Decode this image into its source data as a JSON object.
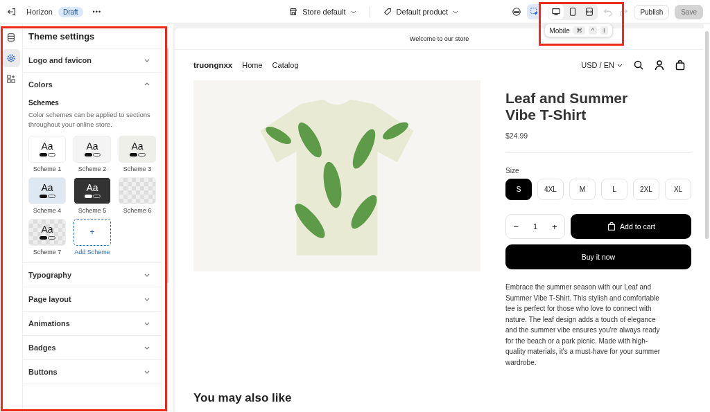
{
  "topbar": {
    "theme": "Horizon",
    "badge": "Draft",
    "more": "•••",
    "store_menu": "Store default",
    "product_menu": "Default product",
    "tools": [
      {
        "kind": "inspect",
        "selected": true
      }
    ],
    "devices": [
      {
        "kind": "desktop",
        "selected": true
      },
      {
        "kind": "mobile",
        "selected": false
      },
      {
        "kind": "full",
        "selected": false
      }
    ],
    "tooltip": {
      "label": "Mobile",
      "keys": [
        "⌘",
        "^",
        "I"
      ]
    },
    "publish": "Publish",
    "save": {
      "label": "Save",
      "disabled": true
    }
  },
  "rail": [
    {
      "kind": "sections",
      "selected": false
    },
    {
      "kind": "settings",
      "selected": true
    },
    {
      "kind": "apps",
      "selected": false
    }
  ],
  "panel": {
    "title": "Theme settings",
    "sections": [
      {
        "label": "Logo and favicon",
        "expanded": false
      },
      {
        "label": "Colors",
        "expanded": true,
        "subtitle": "Schemes",
        "description": "Color schemes can be applied to sections throughout your online store.",
        "schemes": [
          {
            "name": "Scheme 1",
            "kind": "solid",
            "color": "#ffffff",
            "sample": "Aa"
          },
          {
            "name": "Scheme 2",
            "kind": "solid",
            "color": "#f4f4f4",
            "sample": "Aa"
          },
          {
            "name": "Scheme 3",
            "kind": "solid",
            "color": "#efefea",
            "sample": "Aa"
          },
          {
            "name": "Scheme 4",
            "kind": "solid",
            "color": "#dde8f3",
            "sample": "Aa"
          },
          {
            "name": "Scheme 5",
            "kind": "dark",
            "color": "#333333",
            "sample": "Aa"
          },
          {
            "name": "Scheme 6",
            "kind": "transparent",
            "color": "#f0f0f0"
          },
          {
            "name": "Scheme 7",
            "kind": "transparent",
            "color": "#eeeeee",
            "sample": "Aa"
          }
        ],
        "add_label": "Add Scheme",
        "add_icon": "+"
      },
      {
        "label": "Typography",
        "expanded": false
      },
      {
        "label": "Page layout",
        "expanded": false
      },
      {
        "label": "Animations",
        "expanded": false
      },
      {
        "label": "Badges",
        "expanded": false
      },
      {
        "label": "Buttons",
        "expanded": false
      }
    ]
  },
  "preview": {
    "announcement": "Welcome to our store",
    "brand": "truongnxx",
    "nav": [
      "Home",
      "Catalog"
    ],
    "currency": "USD / EN",
    "product": {
      "title": "Leaf and Summer Vibe T-Shirt",
      "price": "$24.99",
      "size_label": "Size",
      "sizes": [
        {
          "label": "S",
          "selected": true
        },
        {
          "label": "4XL",
          "selected": false
        },
        {
          "label": "M",
          "selected": false
        },
        {
          "label": "L",
          "selected": false
        },
        {
          "label": "2XL",
          "selected": false
        },
        {
          "label": "XL",
          "selected": false
        }
      ],
      "quantity": "1",
      "minus": "−",
      "plus": "+",
      "add_to_cart": "Add to cart",
      "buy_now": "Buy it now",
      "description": "Embrace the summer season with our Leaf and Summer Vibe T-Shirt. This stylish and comfortable tee is perfect for those who love to connect with nature. The leaf design adds a touch of elegance and the summer vibe ensures you're always ready for the beach or a park picnic. Made with high-quality materials, it's a must-have for your summer wardrobe."
    },
    "related_heading": "You may also like"
  }
}
